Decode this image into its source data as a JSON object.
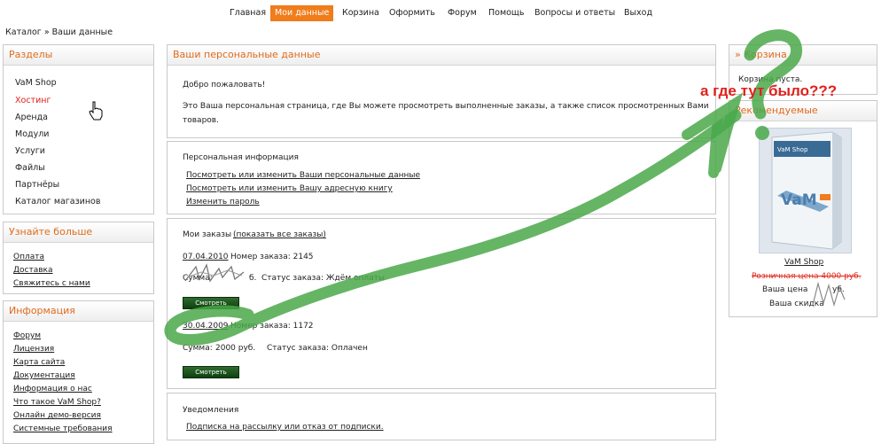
{
  "nav": {
    "items": [
      {
        "label": "Главная"
      },
      {
        "label": "Мои данные"
      },
      {
        "label": "Корзина"
      },
      {
        "label": "Оформить"
      },
      {
        "label": "Форум"
      },
      {
        "label": "Помощь"
      },
      {
        "label": "Вопросы и ответы"
      },
      {
        "label": "Выход"
      }
    ]
  },
  "breadcrumb": "Каталог » Ваши данные",
  "sections": {
    "title": "Разделы",
    "items": [
      "VaM Shop",
      "Хостинг",
      "Аренда",
      "Модули",
      "Услуги",
      "Файлы",
      "Партнёры",
      "Каталог магазинов"
    ]
  },
  "learn_more": {
    "title": "Узнайте больше",
    "links": [
      "Оплата",
      "Доставка",
      "Свяжитесь с нами"
    ]
  },
  "info": {
    "title": "Информация",
    "links": [
      "Форум",
      "Лицензия",
      "Карта сайта",
      "Документация",
      "Информация о нас",
      "Что такое VaM Shop?",
      "Онлайн демо-версия",
      "Системные требования"
    ]
  },
  "personal": {
    "title": "Ваши персональные данные",
    "welcome": "Добро пожаловать!",
    "description_line1": "Это Ваша персональная страница, где Вы можете просмотреть выполненные заказы, а также список просмотренных Вами",
    "description_line2": "товаров.",
    "info_heading": "Персональная информация",
    "links": [
      "Посмотреть или изменить Ваши персональные данные",
      "Посмотреть или изменить Вашу адресную книгу",
      "Изменить пароль"
    ]
  },
  "orders": {
    "heading": "Мои заказы",
    "show_all": "(показать все заказы)",
    "list": [
      {
        "date": "07.04.2010",
        "number_label": "Номер заказа: 2145",
        "sum_prefix": "Сумма:",
        "sum_value": "",
        "sum_suffix": "б.",
        "status": "Статус заказа: Ждём оплаты",
        "button": "Смотреть"
      },
      {
        "date": "30.04.2009",
        "number_label": "Номер заказа: 1172",
        "sum_prefix": "Сумма:",
        "sum_value": "2000 руб.",
        "sum_suffix": "",
        "status": "Статус заказа: Оплачен",
        "button": "Смотреть"
      }
    ]
  },
  "notifications": {
    "heading": "Уведомления",
    "link": "Подписка на рассылку или отказ от подписки."
  },
  "cart": {
    "title": "» Корзина",
    "empty_text": "Корзина пуста."
  },
  "recommended": {
    "title": "Рекомендуемые",
    "product_name": "VaM Shop",
    "box_brand": "VaM Shop",
    "box_logo": "VaM",
    "retail_price": "Розничная цена 4000 руб.",
    "your_price": "Ваша цена",
    "your_price_suffix": "уб.",
    "discount": "Ваша скидка"
  },
  "annotation": {
    "text": "а где тут было???",
    "question_mark": "?",
    "color": "#e0211c",
    "arrow_color": "#4aa84a"
  }
}
